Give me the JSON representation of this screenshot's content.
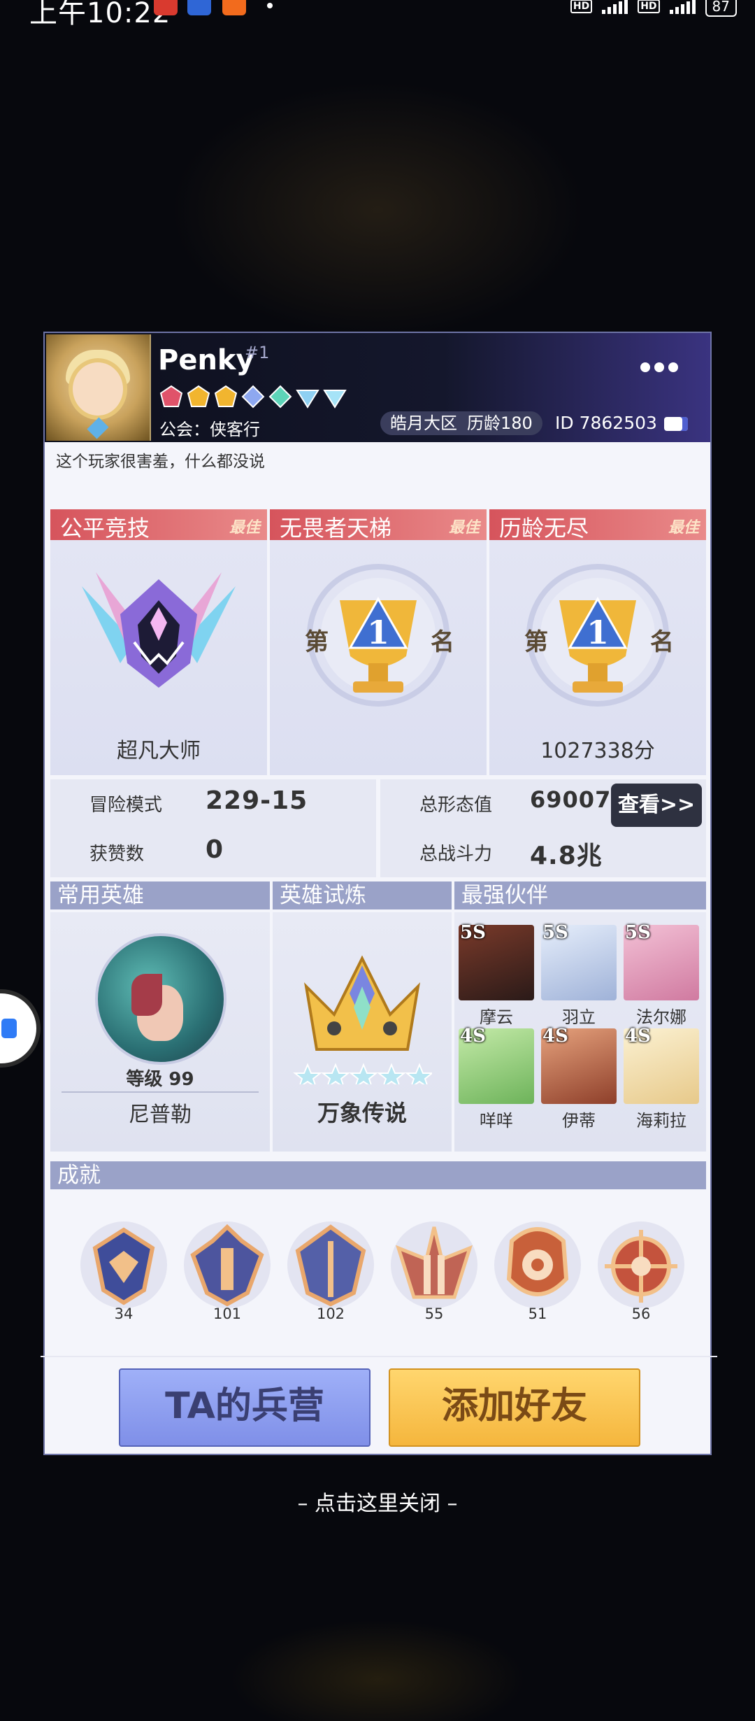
{
  "status_bar": {
    "time": "上午10:22",
    "notif_apps": [
      "看点",
      "国家",
      "mi"
    ],
    "battery": "87",
    "network": [
      "HD",
      "HD"
    ]
  },
  "profile": {
    "name": "Penky",
    "rank_no": "#1",
    "guild": "公会：侠客行",
    "server": "皓月大区",
    "age": "历龄180",
    "id": "ID 7862503",
    "bio": "这个玩家很害羞，什么都没说"
  },
  "ranks": [
    {
      "title": "公平竞技",
      "best": "最佳",
      "caption": "超凡大师"
    },
    {
      "title": "无畏者天梯",
      "best": "最佳",
      "ord_left": "第",
      "ord_num": "1",
      "ord_right": "名",
      "caption": ""
    },
    {
      "title": "历龄无尽",
      "best": "最佳",
      "ord_left": "第",
      "ord_num": "1",
      "ord_right": "名",
      "caption": "1027338分"
    }
  ],
  "stats": {
    "adventure_label": "冒险模式",
    "adventure_value": "229-15",
    "likes_label": "获赞数",
    "likes_value": "0",
    "form_label": "总形态值",
    "form_value": "690077",
    "power_label": "总战斗力",
    "power_value": "4.8兆",
    "view_button": "查看>>"
  },
  "sections": {
    "common_hero": "常用英雄",
    "hero_trial": "英雄试炼",
    "best_partner": "最强伙伴",
    "achievements": "成就"
  },
  "common_hero": {
    "level": "等级 99",
    "name": "尼普勒"
  },
  "hero_trial": {
    "title": "万象传说"
  },
  "partners": [
    {
      "tier": "5S",
      "name": "摩云",
      "color": "#7a3a2a"
    },
    {
      "tier": "5S",
      "name": "羽立",
      "color": "#c9d7ee"
    },
    {
      "tier": "5S",
      "name": "法尔娜",
      "color": "#e7a9c4"
    },
    {
      "tier": "4S",
      "name": "咩咩",
      "color": "#9fd68a"
    },
    {
      "tier": "4S",
      "name": "伊蒂",
      "color": "#c0664a"
    },
    {
      "tier": "4S",
      "name": "海莉拉",
      "color": "#f1e3b5"
    }
  ],
  "achievements": [
    {
      "count": "34",
      "color": "#3f4d9a"
    },
    {
      "count": "101",
      "color": "#4d559e"
    },
    {
      "count": "102",
      "color": "#5460a8"
    },
    {
      "count": "55",
      "color": "#c06455"
    },
    {
      "count": "51",
      "color": "#c8603a"
    },
    {
      "count": "56",
      "color": "#c4533d"
    }
  ],
  "buttons": {
    "camp": "TA的兵营",
    "add_friend": "添加好友"
  },
  "close_hint": "– 点击这里关闭 –",
  "colors": {
    "rank_header": "#d6545c",
    "section_header": "#9aa2c8",
    "camp_button": "#8f9ff0",
    "add_button": "#f5c04e"
  }
}
